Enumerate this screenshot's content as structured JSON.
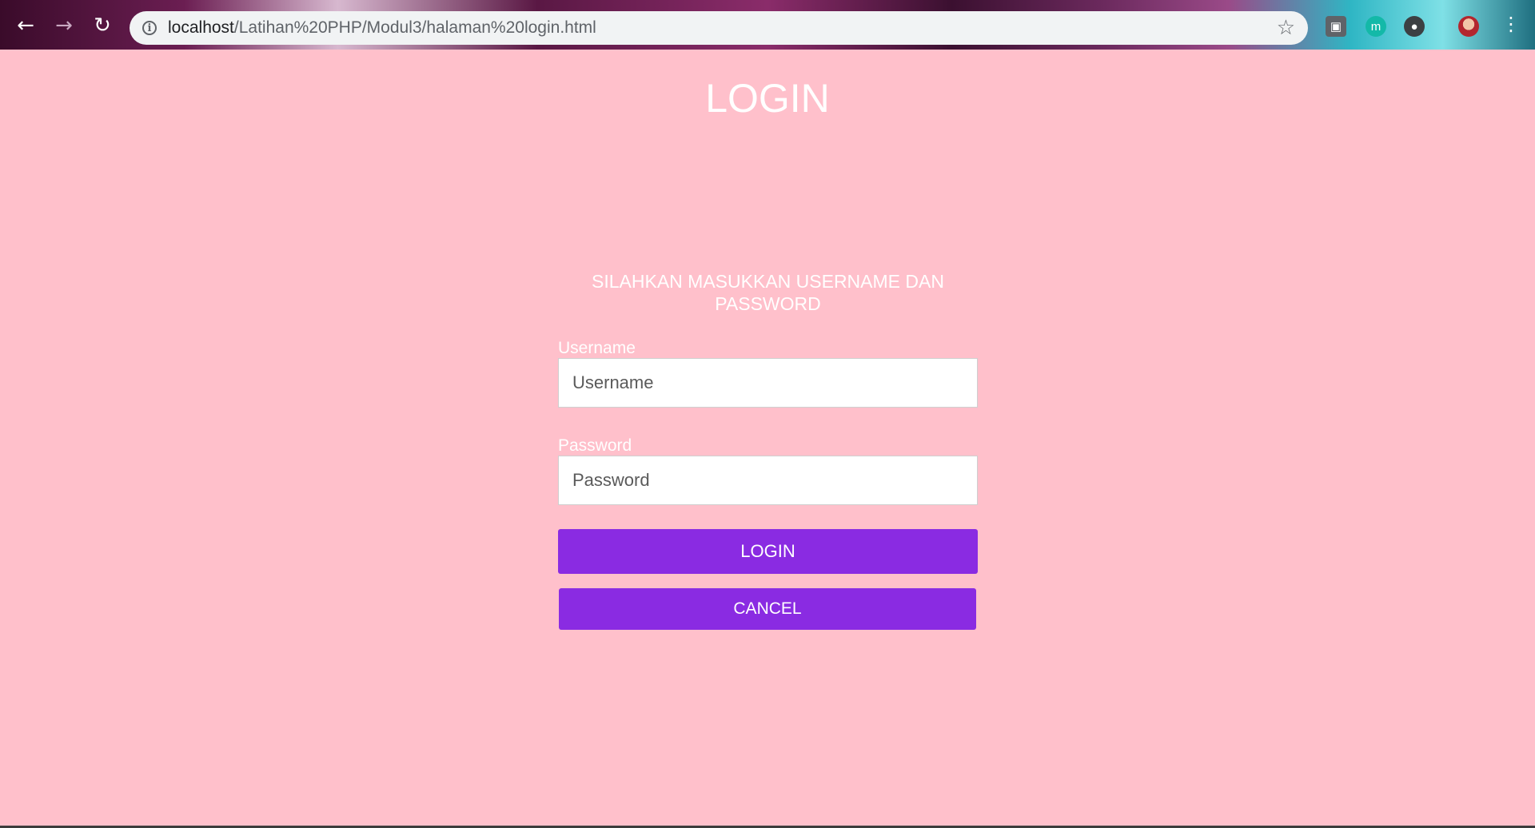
{
  "browser": {
    "url_host": "localhost",
    "url_path": "/Latihan%20PHP/Modul3/halaman%20login.html",
    "icons": {
      "back": "back-arrow-icon",
      "forward": "forward-arrow-icon",
      "reload": "reload-icon",
      "info": "info-icon",
      "bookmark": "star-icon",
      "menu": "kebab-menu-icon"
    }
  },
  "page": {
    "title": "LOGIN",
    "instruction": "SILAHKAN MASUKKAN USERNAME DAN PASSWORD",
    "background_color": "#ffc0cb",
    "accent_color": "#8a2be2"
  },
  "form": {
    "username_label": "Username",
    "username_placeholder": "Username",
    "password_label": "Password",
    "password_placeholder": "Password",
    "login_label": "LOGIN",
    "cancel_label": "CANCEL"
  }
}
